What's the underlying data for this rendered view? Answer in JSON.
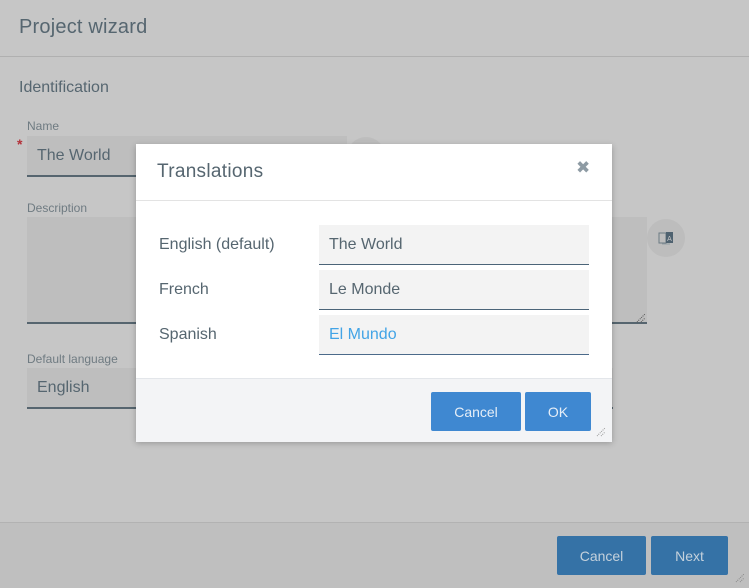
{
  "wizard": {
    "title": "Project wizard",
    "section": "Identification",
    "name_label": "Name",
    "name_value": "The World",
    "required_mark": "*",
    "description_label": "Description",
    "description_value": "",
    "default_language_label": "Default language",
    "default_language_value": "English",
    "buttons": {
      "cancel": "Cancel",
      "next": "Next"
    }
  },
  "dialog": {
    "title": "Translations",
    "close_glyph": "✖",
    "rows": [
      {
        "label": "English (default)",
        "value": "The World"
      },
      {
        "label": "French",
        "value": "Le Monde"
      },
      {
        "label": "Spanish",
        "value": "El Mundo"
      }
    ],
    "buttons": {
      "cancel": "Cancel",
      "ok": "OK"
    }
  },
  "colors": {
    "primary_button": "#3f88d1",
    "focused_text": "#43a4e6",
    "required": "#b3323a"
  }
}
